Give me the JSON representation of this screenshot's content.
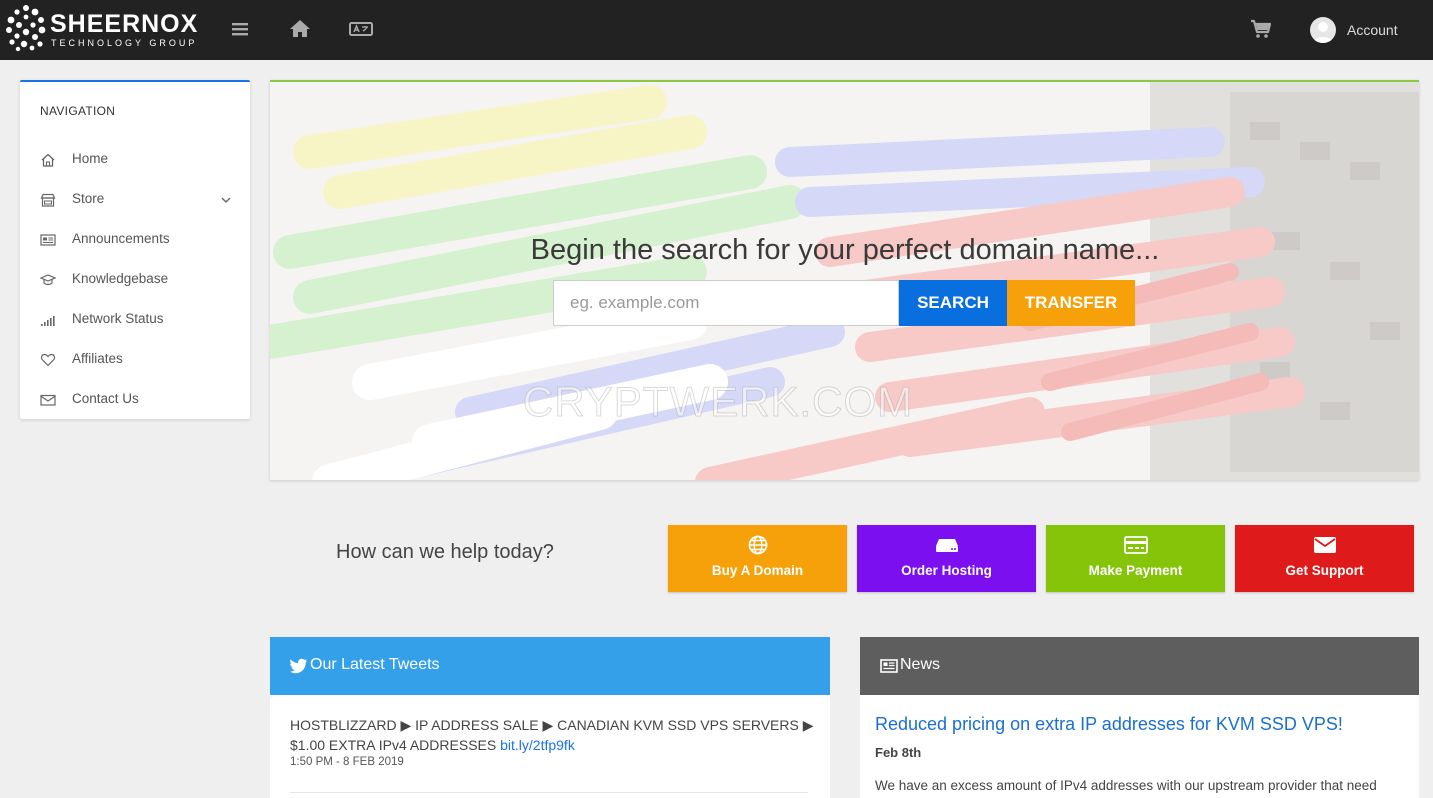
{
  "header": {
    "brand_name": "SHEERNOX",
    "brand_tagline": "TECHNOLOGY GROUP",
    "account_label": "Account"
  },
  "sidebar": {
    "title": "NAVIGATION",
    "items": [
      {
        "label": "Home",
        "icon": "home-icon"
      },
      {
        "label": "Store",
        "icon": "store-icon"
      },
      {
        "label": "Announcements",
        "icon": "announcements-icon"
      },
      {
        "label": "Knowledgebase",
        "icon": "graduation-cap-icon"
      },
      {
        "label": "Network Status",
        "icon": "signal-bars-icon"
      },
      {
        "label": "Affiliates",
        "icon": "heart-icon"
      },
      {
        "label": "Contact Us",
        "icon": "envelope-icon"
      }
    ]
  },
  "hero": {
    "title": "Begin the search for your perfect domain name...",
    "input_placeholder": "eg. example.com",
    "search_label": "SEARCH",
    "transfer_label": "TRANSFER",
    "watermark": "CRYPTWERK.COM"
  },
  "help": {
    "title": "How can we help today?",
    "actions": [
      {
        "label": "Buy A Domain",
        "icon": "globe-icon",
        "color": "#f7a10a"
      },
      {
        "label": "Order Hosting",
        "icon": "server-icon",
        "color": "#7b0ff0"
      },
      {
        "label": "Make Payment",
        "icon": "credit-card-icon",
        "color": "#86c40a"
      },
      {
        "label": "Get Support",
        "icon": "envelope-icon",
        "color": "#de1a1a"
      }
    ]
  },
  "tweets": {
    "title": "Our Latest Tweets",
    "color": "#35a0ea",
    "items": [
      {
        "text": "HOSTBLIZZARD ▶ IP ADDRESS SALE ▶ CANADIAN KVM SSD VPS SERVERS ▶ $1.00 EXTRA IPv4 ADDRESSES ",
        "link": "bit.ly/2tfp9fk",
        "time": "1:50 PM - 8 FEB 2019"
      }
    ]
  },
  "news": {
    "title": "News",
    "color": "#5e5e5e",
    "items": [
      {
        "title": "Reduced pricing on extra IP addresses for KVM SSD VPS!",
        "date": "Feb 8th",
        "body": "We have an excess amount of IPv4 addresses with our upstream provider that need"
      }
    ]
  }
}
